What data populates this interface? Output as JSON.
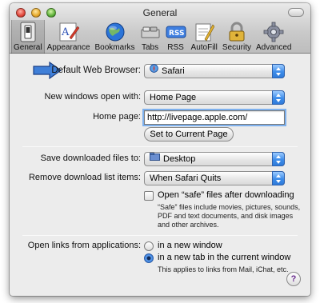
{
  "window": {
    "title": "General"
  },
  "toolbar": {
    "items": [
      {
        "label": "General",
        "icon": "general-switch-icon",
        "active": true
      },
      {
        "label": "Appearance",
        "icon": "appearance-icon",
        "active": false
      },
      {
        "label": "Bookmarks",
        "icon": "bookmarks-globe-icon",
        "active": false
      },
      {
        "label": "Tabs",
        "icon": "tabs-icon",
        "active": false
      },
      {
        "label": "RSS",
        "icon": "rss-icon",
        "active": false
      },
      {
        "label": "AutoFill",
        "icon": "autofill-icon",
        "active": false
      },
      {
        "label": "Security",
        "icon": "lock-icon",
        "active": false
      },
      {
        "label": "Advanced",
        "icon": "gear-icon",
        "active": false
      }
    ]
  },
  "prefs": {
    "default_browser": {
      "label": "Default Web Browser:",
      "value": "Safari"
    },
    "new_windows": {
      "label": "New windows open with:",
      "value": "Home Page"
    },
    "home_page": {
      "label": "Home page:",
      "value": "http://livepage.apple.com/",
      "button": "Set to Current Page"
    },
    "save_downloads": {
      "label": "Save downloaded files to:",
      "value": "Desktop"
    },
    "remove_downloads": {
      "label": "Remove download list items:",
      "value": "When Safari Quits"
    },
    "safe_files": {
      "checkbox_label": "Open “safe” files after downloading",
      "note_line1": "“Safe” files include movies, pictures, sounds,",
      "note_line2": "PDF and text documents, and disk images",
      "note_line3": "and other archives."
    },
    "open_links": {
      "label": "Open links from applications:",
      "option1": "in a new window",
      "option2": "in a new tab in the current window",
      "note": "This applies to links from Mail, iChat, etc.",
      "selected": "option2"
    },
    "help_label": "?"
  },
  "colors": {
    "accent": "#3e8dea",
    "callout_arrow": "#3f7fd8"
  }
}
